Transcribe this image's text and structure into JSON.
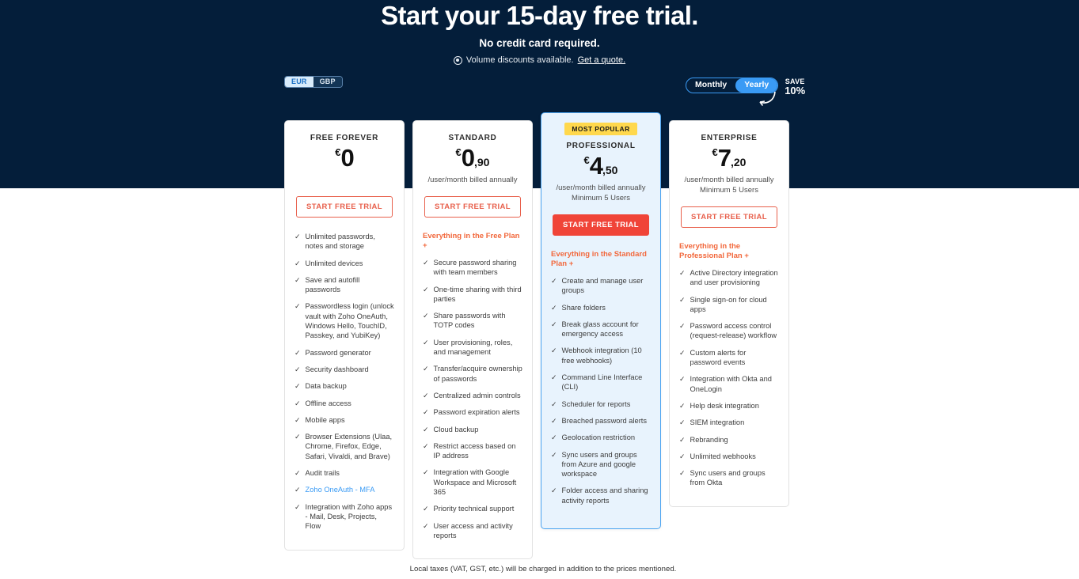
{
  "hero": {
    "title": "Start your 15-day free trial.",
    "subtitle": "No credit card required.",
    "note_text": "Volume discounts available.",
    "note_link": "Get a quote.",
    "note_icon": "info-circle-icon"
  },
  "currency_toggle": {
    "options": [
      "EUR",
      "GBP"
    ],
    "selected": "EUR"
  },
  "billing_toggle": {
    "options": [
      "Monthly",
      "Yearly"
    ],
    "selected": "Yearly",
    "save_label": "SAVE",
    "save_value": "10%",
    "arrow_icon": "curved-arrow-icon"
  },
  "colors": {
    "dark_band": "#041E3A",
    "accent_blue": "#3a9bf5",
    "accent_orange": "#f2683c",
    "cta_red": "#e8604c",
    "cta_filled": "#f04438",
    "badge_yellow": "#ffd84d",
    "featured_bg": "#e8f3fd"
  },
  "footnote": "Local taxes (VAT, GST, etc.) will be charged in addition to the prices mentioned.",
  "plans": [
    {
      "name": "FREE FOREVER",
      "currency": "€",
      "price": "0",
      "decimals": "",
      "billing_note": "",
      "min_users": "",
      "cta": "START FREE TRIAL",
      "cta_style": "outline",
      "badge": "",
      "features_heading": "",
      "features": [
        {
          "text": "Unlimited passwords, notes and storage",
          "link": false
        },
        {
          "text": "Unlimited devices",
          "link": false
        },
        {
          "text": "Save and autofill passwords",
          "link": false
        },
        {
          "text": "Passwordless login (unlock vault with Zoho OneAuth, Windows Hello, TouchID, Passkey, and YubiKey)",
          "link": false
        },
        {
          "text": "Password generator",
          "link": false
        },
        {
          "text": "Security dashboard",
          "link": false
        },
        {
          "text": "Data backup",
          "link": false
        },
        {
          "text": "Offline access",
          "link": false
        },
        {
          "text": "Mobile apps",
          "link": false
        },
        {
          "text": "Browser Extensions (Ulaa, Chrome, Firefox, Edge, Safari, Vivaldi, and Brave)",
          "link": false
        },
        {
          "text": "Audit trails",
          "link": false
        },
        {
          "text": "Zoho OneAuth - MFA",
          "link": true
        },
        {
          "text": "Integration with Zoho apps - Mail, Desk, Projects, Flow",
          "link": false
        }
      ]
    },
    {
      "name": "STANDARD",
      "currency": "€",
      "price": "0",
      "decimals": ",90",
      "billing_note": "/user/month billed annually",
      "min_users": "",
      "cta": "START FREE TRIAL",
      "cta_style": "outline",
      "badge": "",
      "features_heading": "Everything in the Free Plan +",
      "features": [
        {
          "text": "Secure password sharing with team members",
          "link": false
        },
        {
          "text": "One-time sharing with third parties",
          "link": false
        },
        {
          "text": "Share passwords with TOTP codes",
          "link": false
        },
        {
          "text": "User provisioning, roles, and management",
          "link": false
        },
        {
          "text": "Transfer/acquire ownership of passwords",
          "link": false
        },
        {
          "text": "Centralized admin controls",
          "link": false
        },
        {
          "text": "Password expiration alerts",
          "link": false
        },
        {
          "text": "Cloud backup",
          "link": false
        },
        {
          "text": "Restrict access based on IP address",
          "link": false
        },
        {
          "text": "Integration with Google Workspace and Microsoft 365",
          "link": false
        },
        {
          "text": "Priority technical support",
          "link": false
        },
        {
          "text": "User access and activity reports",
          "link": false
        }
      ]
    },
    {
      "name": "PROFESSIONAL",
      "currency": "€",
      "price": "4",
      "decimals": ",50",
      "billing_note": "/user/month billed annually",
      "min_users": "Minimum 5 Users",
      "cta": "START FREE TRIAL",
      "cta_style": "filled",
      "badge": "MOST POPULAR",
      "features_heading": "Everything in the Standard Plan +",
      "features": [
        {
          "text": "Create and manage user groups",
          "link": false
        },
        {
          "text": "Share folders",
          "link": false
        },
        {
          "text": "Break glass account for emergency access",
          "link": false
        },
        {
          "text": "Webhook integration (10 free webhooks)",
          "link": false
        },
        {
          "text": "Command Line Interface (CLI)",
          "link": false
        },
        {
          "text": "Scheduler for reports",
          "link": false
        },
        {
          "text": "Breached password alerts",
          "link": false
        },
        {
          "text": "Geolocation restriction",
          "link": false
        },
        {
          "text": "Sync users and groups from Azure and google workspace",
          "link": false
        },
        {
          "text": "Folder access and sharing activity reports",
          "link": false
        }
      ]
    },
    {
      "name": "ENTERPRISE",
      "currency": "€",
      "price": "7",
      "decimals": ",20",
      "billing_note": "/user/month billed annually",
      "min_users": "Minimum 5 Users",
      "cta": "START FREE TRIAL",
      "cta_style": "outline",
      "badge": "",
      "features_heading": "Everything in the Professional Plan +",
      "features": [
        {
          "text": "Active Directory integration and user provisioning",
          "link": false
        },
        {
          "text": "Single sign-on for cloud apps",
          "link": false
        },
        {
          "text": "Password access control (request-release) workflow",
          "link": false
        },
        {
          "text": "Custom alerts for password events",
          "link": false
        },
        {
          "text": "Integration with Okta and OneLogin",
          "link": false
        },
        {
          "text": "Help desk integration",
          "link": false
        },
        {
          "text": "SIEM integration",
          "link": false
        },
        {
          "text": "Rebranding",
          "link": false
        },
        {
          "text": "Unlimited webhooks",
          "link": false
        },
        {
          "text": "Sync users and groups from Okta",
          "link": false
        }
      ]
    }
  ]
}
